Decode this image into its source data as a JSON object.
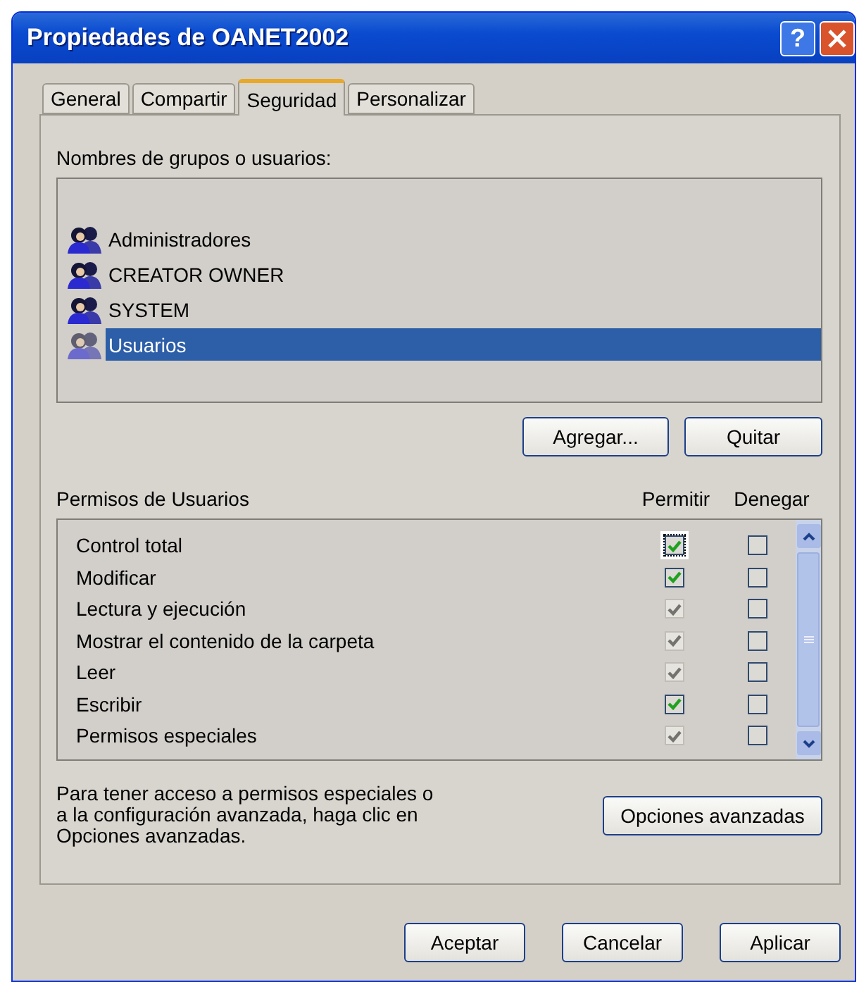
{
  "window": {
    "title": "Propiedades de OANET2002",
    "help_button": "?"
  },
  "tabs": [
    {
      "label": "General",
      "selected": false
    },
    {
      "label": "Compartir",
      "selected": false
    },
    {
      "label": "Seguridad",
      "selected": true
    },
    {
      "label": "Personalizar",
      "selected": false
    }
  ],
  "groups": {
    "label": "Nombres de grupos o usuarios:",
    "items": [
      {
        "name": "Administradores",
        "selected": false
      },
      {
        "name": "CREATOR OWNER",
        "selected": false
      },
      {
        "name": "SYSTEM",
        "selected": false
      },
      {
        "name": "Usuarios",
        "selected": true
      }
    ],
    "buttons": [
      "Agregar...",
      "Quitar"
    ]
  },
  "permissions": {
    "label": "Permisos de Usuarios",
    "allow_header": "Permitir",
    "deny_header": "Denegar",
    "rows": [
      {
        "name": "Control total",
        "allow": {
          "checked": true,
          "disabled": false,
          "focused": true
        },
        "deny": {
          "checked": false
        }
      },
      {
        "name": "Modificar",
        "allow": {
          "checked": true,
          "disabled": false,
          "focused": false
        },
        "deny": {
          "checked": false
        }
      },
      {
        "name": "Lectura y ejecución",
        "allow": {
          "checked": true,
          "disabled": true,
          "focused": false
        },
        "deny": {
          "checked": false
        }
      },
      {
        "name": "Mostrar el contenido de la carpeta",
        "allow": {
          "checked": true,
          "disabled": true,
          "focused": false
        },
        "deny": {
          "checked": false
        }
      },
      {
        "name": "Leer",
        "allow": {
          "checked": true,
          "disabled": true,
          "focused": false
        },
        "deny": {
          "checked": false
        }
      },
      {
        "name": "Escribir",
        "allow": {
          "checked": true,
          "disabled": false,
          "focused": false
        },
        "deny": {
          "checked": false
        }
      },
      {
        "name": "Permisos especiales",
        "allow": {
          "checked": true,
          "disabled": true,
          "focused": false
        },
        "deny": {
          "checked": false
        }
      }
    ]
  },
  "advanced": {
    "text": "Para tener acceso a permisos especiales o a la configuración avanzada, haga clic en Opciones avanzadas.",
    "button": "Opciones avanzadas"
  },
  "footer_buttons": [
    "Aceptar",
    "Cancelar",
    "Aplicar"
  ]
}
